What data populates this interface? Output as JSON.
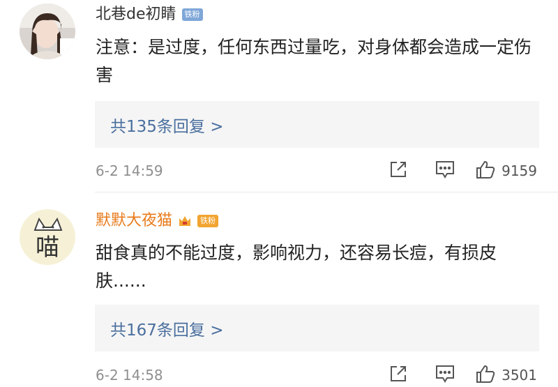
{
  "comments": [
    {
      "username": "北巷de初睛",
      "badge": "铁粉",
      "content": "注意：是过度，任何东西过量吃，对身体都会造成一定伤害",
      "replies": "共135条回复 >",
      "timestamp": "6-2 14:59",
      "likes": "9159"
    },
    {
      "username": "默默大夜猫",
      "badge": "铁粉",
      "content": "甜食真的不能过度，影响视力，还容易长痘，有损皮肤......",
      "replies": "共167条回复 >",
      "timestamp": "6-2 14:58",
      "likes": "3501"
    }
  ],
  "avatar2_text": "喵"
}
